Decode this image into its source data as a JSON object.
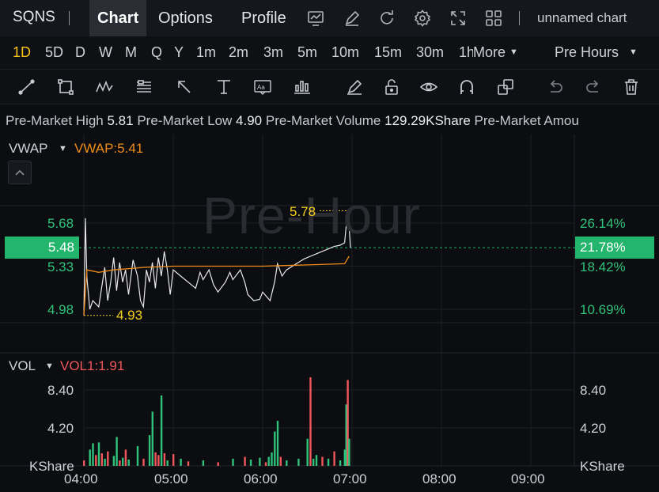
{
  "header": {
    "symbol": "SQNS",
    "tabs": [
      {
        "label": "Chart",
        "active": true
      },
      {
        "label": "Options",
        "active": false
      },
      {
        "label": "Profile",
        "active": false
      }
    ],
    "icons": [
      "line-chart-icon",
      "pencil-icon",
      "refresh-icon",
      "gear-icon",
      "fullscreen-icon",
      "layout-grid-icon"
    ],
    "chart_name": "unnamed chart"
  },
  "intervals": {
    "items": [
      "1D",
      "5D",
      "D",
      "W",
      "M",
      "Q",
      "Y",
      "1m",
      "2m",
      "3m",
      "5m",
      "10m",
      "15m",
      "30m",
      "1h"
    ],
    "active": "1D",
    "more_label": "More",
    "session_label": "Pre Hours"
  },
  "toolbar": {
    "tools": [
      "trend-line-icon",
      "rectangle-icon",
      "pattern-icon",
      "fib-icon",
      "arrow-icon",
      "measure-icon",
      "text-icon",
      "candles-icon",
      "brush-icon",
      "lock-icon",
      "eye-icon",
      "magnet-icon",
      "clone-icon",
      "undo-icon",
      "redo-icon",
      "trash-icon"
    ]
  },
  "stats": {
    "high_label": "Pre-Market High",
    "high_value": "5.81",
    "low_label": "Pre-Market Low",
    "low_value": "4.90",
    "volume_label": "Pre-Market Volume",
    "volume_value": "129.29KShare",
    "amount_label": "Pre-Market Amou"
  },
  "price_panel": {
    "indicator": "VWAP",
    "indicator_value": "VWAP:5.41",
    "watermark": "Pre-Hour",
    "current_price": "5.48",
    "current_pct": "21.78%",
    "high_marker": "5.78",
    "low_marker": "4.93"
  },
  "volume_panel": {
    "indicator": "VOL",
    "indicator_value": "VOL1:1.91",
    "unit_left": "KShare",
    "unit_right": "KShare"
  },
  "colors": {
    "up": "#2fc27a",
    "down": "#f0575b",
    "vwap": "#f08c1a",
    "price": "#e8e8e8",
    "marker": "#f5d020",
    "accent": "#23b56b"
  },
  "chart_data": {
    "type": "line",
    "x_ticks": [
      "04:00",
      "05:00",
      "06:00",
      "07:00",
      "08:00",
      "09:00"
    ],
    "x_range": [
      "04:00",
      "09:30"
    ],
    "y_ticks_left": [
      "5.68",
      "5.33",
      "4.98"
    ],
    "y_ticks_right": [
      "26.14%",
      "18.42%",
      "10.69%"
    ],
    "y_range": [
      4.8,
      5.9
    ],
    "price": [
      [
        "04:00",
        4.93
      ],
      [
        "04:01",
        5.72
      ],
      [
        "04:02",
        5.24
      ],
      [
        "04:04",
        4.98
      ],
      [
        "04:06",
        5.05
      ],
      [
        "04:10",
        5.0
      ],
      [
        "04:14",
        5.32
      ],
      [
        "04:16",
        5.05
      ],
      [
        "04:18",
        5.2
      ],
      [
        "04:20",
        5.4
      ],
      [
        "04:22",
        5.13
      ],
      [
        "04:24",
        5.36
      ],
      [
        "04:26",
        5.2
      ],
      [
        "04:28",
        5.3
      ],
      [
        "04:30",
        5.1
      ],
      [
        "04:33",
        5.38
      ],
      [
        "04:36",
        5.25
      ],
      [
        "04:38",
        5.05
      ],
      [
        "04:40",
        5.0
      ],
      [
        "04:42",
        5.3
      ],
      [
        "04:44",
        5.2
      ],
      [
        "04:46",
        5.36
      ],
      [
        "04:48",
        5.15
      ],
      [
        "04:50",
        5.4
      ],
      [
        "04:52",
        5.25
      ],
      [
        "04:54",
        5.45
      ],
      [
        "04:56",
        5.3
      ],
      [
        "04:58",
        5.1
      ],
      [
        "05:00",
        5.3
      ],
      [
        "05:05",
        5.25
      ],
      [
        "05:10",
        5.2
      ],
      [
        "05:15",
        5.15
      ],
      [
        "05:18",
        5.28
      ],
      [
        "05:20",
        5.22
      ],
      [
        "05:24",
        5.3
      ],
      [
        "05:27",
        5.18
      ],
      [
        "05:30",
        5.12
      ],
      [
        "05:35",
        5.2
      ],
      [
        "05:38",
        5.28
      ],
      [
        "05:40",
        5.22
      ],
      [
        "05:45",
        5.3
      ],
      [
        "05:48",
        5.2
      ],
      [
        "05:50",
        5.1
      ],
      [
        "05:54",
        5.05
      ],
      [
        "05:58",
        5.06
      ],
      [
        "06:00",
        5.12
      ],
      [
        "06:05",
        5.05
      ],
      [
        "06:08",
        5.2
      ],
      [
        "06:10",
        5.35
      ],
      [
        "06:13",
        5.25
      ],
      [
        "06:16",
        5.3
      ],
      [
        "06:20",
        5.33
      ],
      [
        "06:24",
        5.36
      ],
      [
        "06:28",
        5.39
      ],
      [
        "06:32",
        5.41
      ],
      [
        "06:36",
        5.43
      ],
      [
        "06:40",
        5.45
      ],
      [
        "06:44",
        5.47
      ],
      [
        "06:48",
        5.49
      ],
      [
        "06:52",
        5.5
      ],
      [
        "06:55",
        5.52
      ],
      [
        "06:57",
        5.78
      ],
      [
        "06:58",
        5.65
      ],
      [
        "06:59",
        5.48
      ]
    ],
    "vwap": [
      [
        "04:00",
        4.93
      ],
      [
        "04:02",
        5.3
      ],
      [
        "04:10",
        5.28
      ],
      [
        "04:20",
        5.3
      ],
      [
        "04:40",
        5.32
      ],
      [
        "05:00",
        5.33
      ],
      [
        "05:30",
        5.33
      ],
      [
        "06:00",
        5.33
      ],
      [
        "06:30",
        5.34
      ],
      [
        "06:55",
        5.35
      ],
      [
        "06:58",
        5.41
      ]
    ],
    "volume_y_ticks": [
      "8.40",
      "4.20"
    ],
    "volume_y_range": [
      0,
      10.5
    ],
    "volume": [
      [
        "04:00",
        0.6,
        "down"
      ],
      [
        "04:04",
        1.8,
        "up"
      ],
      [
        "04:06",
        2.5,
        "up"
      ],
      [
        "04:08",
        1.2,
        "down"
      ],
      [
        "04:10",
        2.6,
        "up"
      ],
      [
        "04:12",
        1.4,
        "down"
      ],
      [
        "04:14",
        0.8,
        "up"
      ],
      [
        "04:16",
        1.6,
        "down"
      ],
      [
        "04:20",
        1.1,
        "up"
      ],
      [
        "04:22",
        3.2,
        "up"
      ],
      [
        "04:24",
        0.6,
        "down"
      ],
      [
        "04:26",
        0.9,
        "up"
      ],
      [
        "04:28",
        1.8,
        "down"
      ],
      [
        "04:30",
        0.7,
        "up"
      ],
      [
        "04:36",
        2.2,
        "up"
      ],
      [
        "04:40",
        0.8,
        "down"
      ],
      [
        "04:44",
        3.4,
        "up"
      ],
      [
        "04:46",
        6.0,
        "up"
      ],
      [
        "04:48",
        1.5,
        "down"
      ],
      [
        "04:50",
        1.2,
        "down"
      ],
      [
        "04:52",
        7.8,
        "up"
      ],
      [
        "04:54",
        1.4,
        "down"
      ],
      [
        "04:56",
        0.6,
        "up"
      ],
      [
        "05:00",
        1.3,
        "down"
      ],
      [
        "05:05",
        0.8,
        "up"
      ],
      [
        "05:10",
        0.5,
        "down"
      ],
      [
        "05:20",
        0.6,
        "up"
      ],
      [
        "05:30",
        0.4,
        "down"
      ],
      [
        "05:40",
        0.8,
        "up"
      ],
      [
        "05:48",
        1.0,
        "down"
      ],
      [
        "05:52",
        0.7,
        "up"
      ],
      [
        "05:58",
        0.9,
        "up"
      ],
      [
        "06:02",
        0.4,
        "down"
      ],
      [
        "06:04",
        1.0,
        "up"
      ],
      [
        "06:06",
        1.5,
        "up"
      ],
      [
        "06:08",
        3.8,
        "up"
      ],
      [
        "06:10",
        5.0,
        "up"
      ],
      [
        "06:12",
        1.0,
        "down"
      ],
      [
        "06:16",
        0.6,
        "up"
      ],
      [
        "06:24",
        0.8,
        "up"
      ],
      [
        "06:30",
        3.0,
        "up"
      ],
      [
        "06:32",
        9.8,
        "down"
      ],
      [
        "06:34",
        0.8,
        "up"
      ],
      [
        "06:36",
        1.2,
        "up"
      ],
      [
        "06:40",
        1.0,
        "down"
      ],
      [
        "06:44",
        0.8,
        "up"
      ],
      [
        "06:48",
        1.6,
        "down"
      ],
      [
        "06:52",
        0.6,
        "up"
      ],
      [
        "06:55",
        1.8,
        "up"
      ],
      [
        "06:56",
        6.8,
        "up"
      ],
      [
        "06:57",
        9.5,
        "down"
      ],
      [
        "06:58",
        3.0,
        "up"
      ]
    ]
  }
}
